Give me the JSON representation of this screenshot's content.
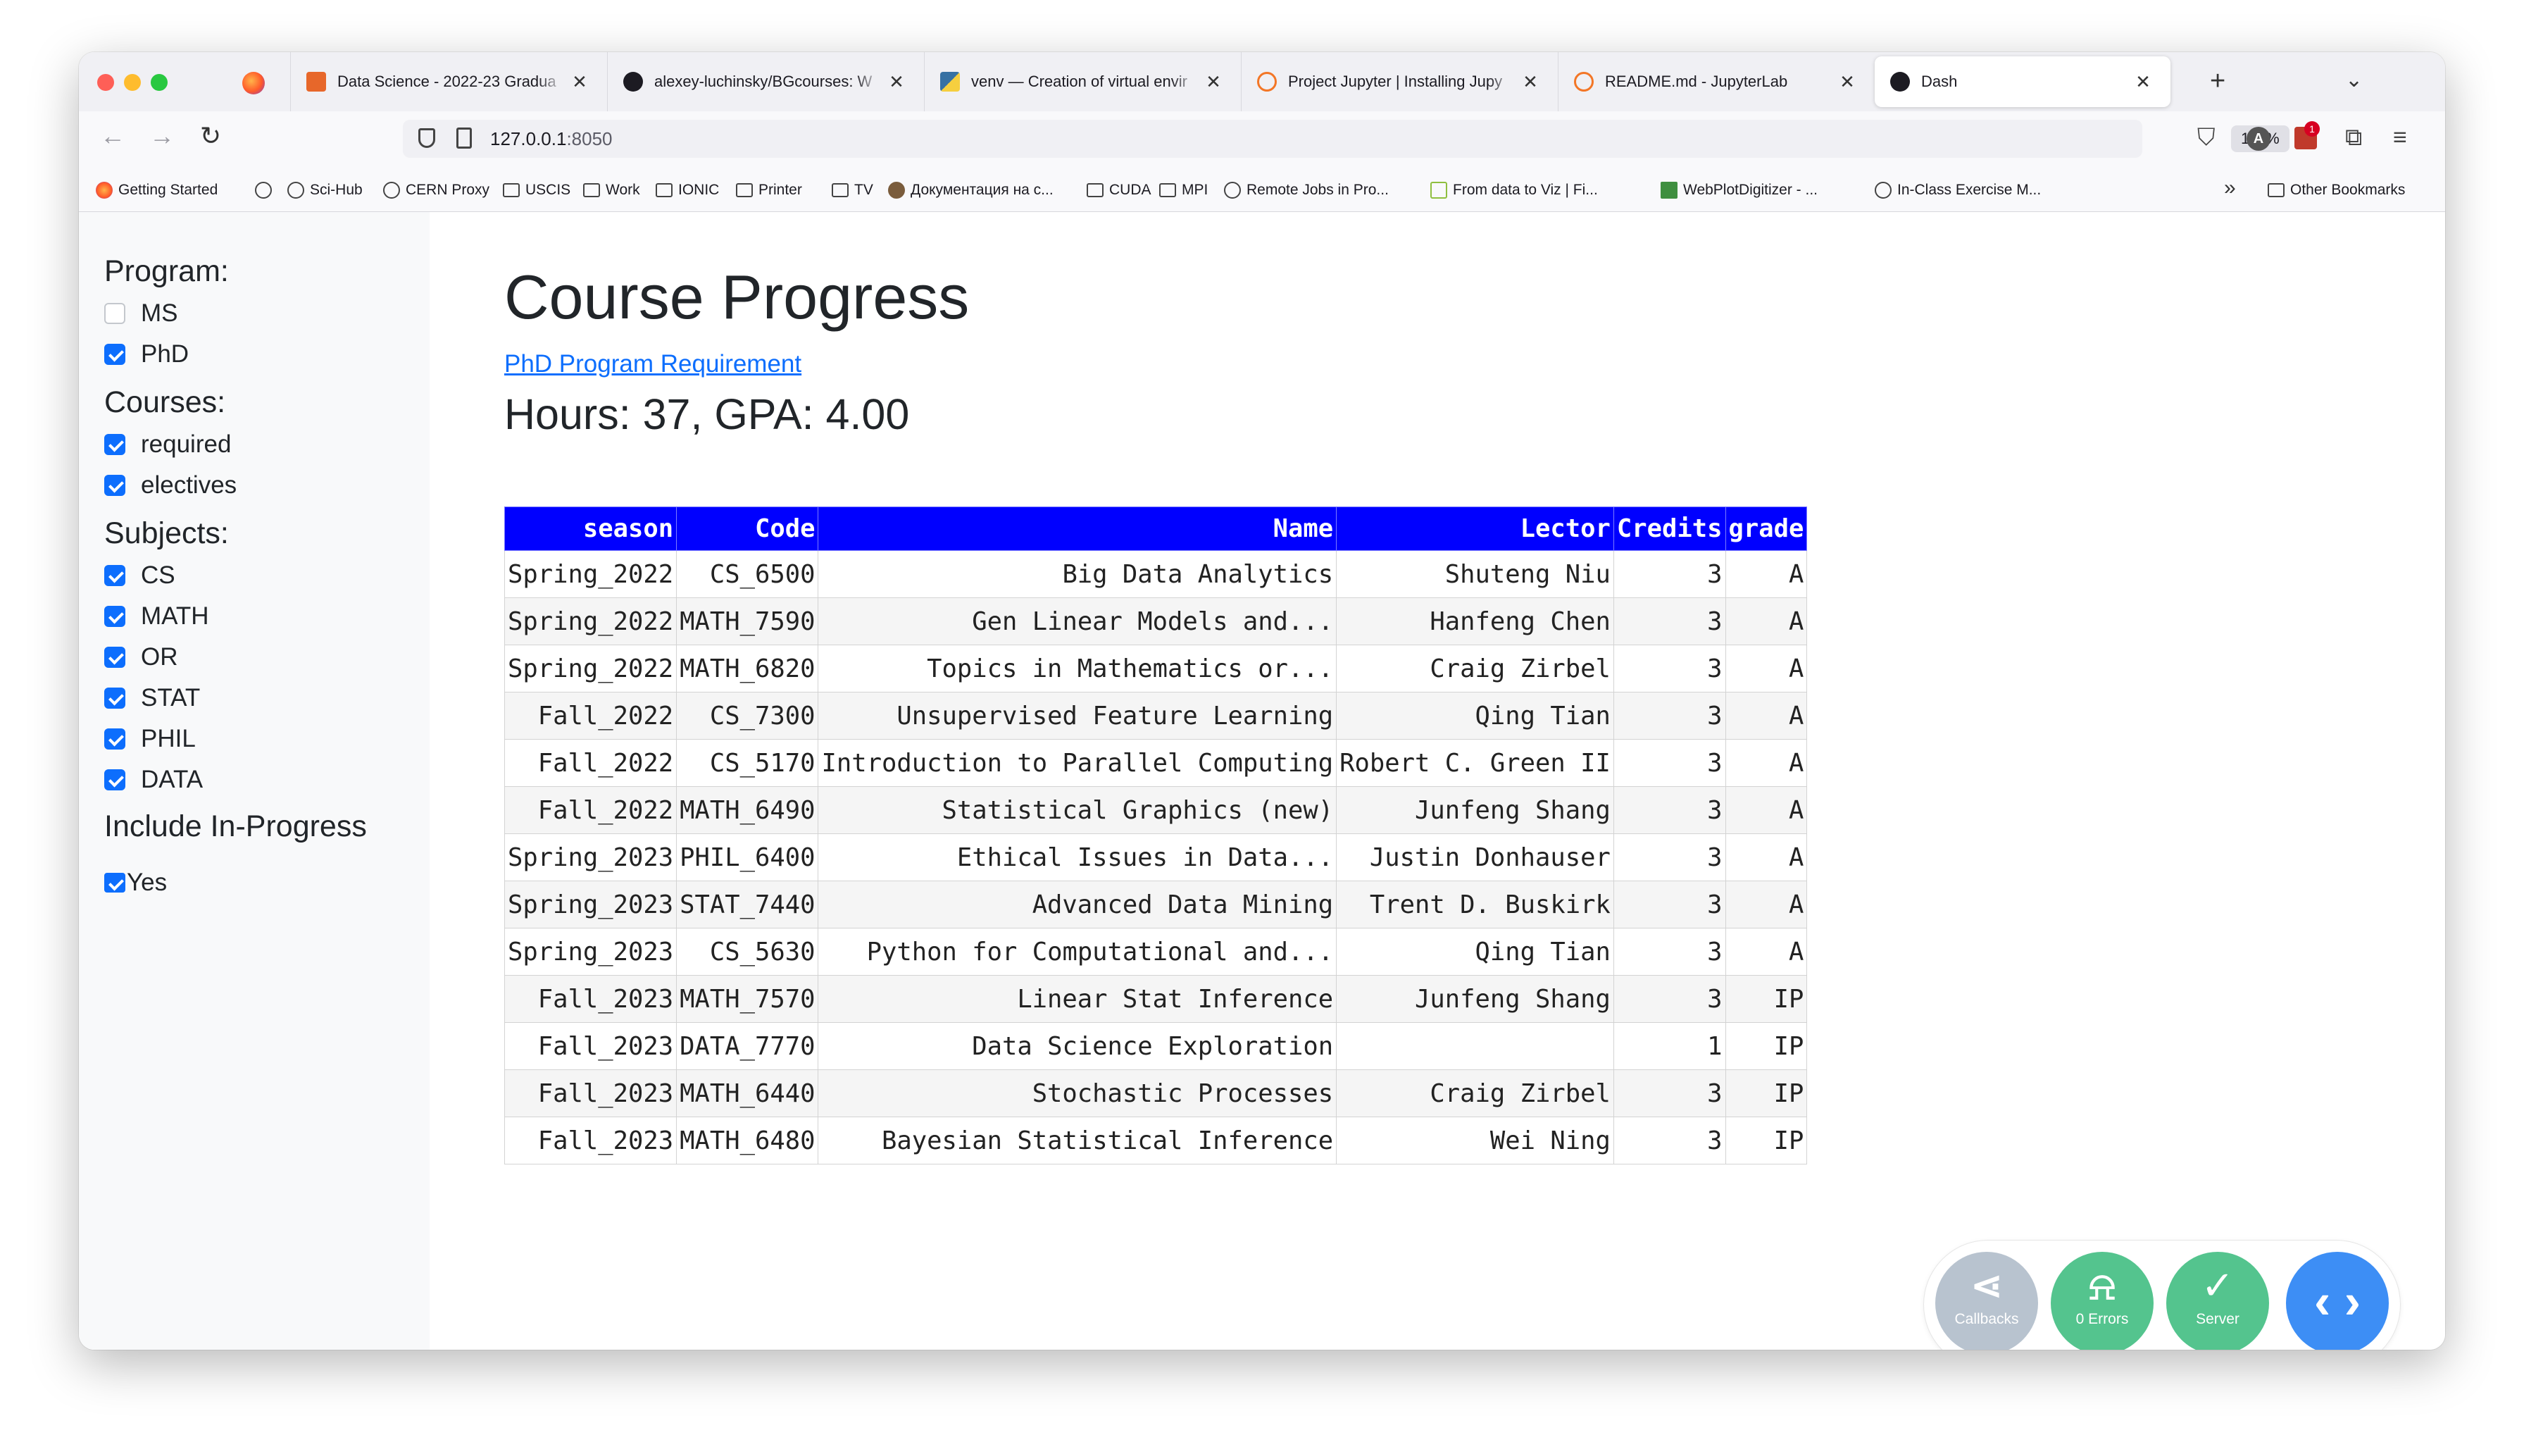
{
  "browser": {
    "tabs": [
      {
        "title": "Data Science - 2022-23 Gradua",
        "icon": "ds-favicon-icon"
      },
      {
        "title": "alexey-luchinsky/BGcourses: W",
        "icon": "github-icon"
      },
      {
        "title": "venv — Creation of virtual envir",
        "icon": "python-icon"
      },
      {
        "title": "Project Jupyter | Installing Jupy",
        "icon": "jupyter-icon"
      },
      {
        "title": "README.md - JupyterLab",
        "icon": "jupyter-icon"
      },
      {
        "title": "Dash",
        "icon": "dash-icon",
        "active": true
      }
    ],
    "close_glyph": "✕",
    "new_tab_glyph": "+",
    "tab_list_glyph": "⌄",
    "url_host": "127.0.0.1",
    "url_port": ":8050",
    "zoom": "110%",
    "avatar_letter": "A",
    "ext_badge": "1",
    "bookmarks": [
      {
        "label": "Getting Started",
        "icon": "fx"
      },
      {
        "label": "",
        "icon": "globe"
      },
      {
        "label": "Sci-Hub",
        "icon": "globe"
      },
      {
        "label": "CERN Proxy",
        "icon": "globe"
      },
      {
        "label": "USCIS",
        "icon": "folder"
      },
      {
        "label": "Work",
        "icon": "folder"
      },
      {
        "label": "IONIC",
        "icon": "folder"
      },
      {
        "label": "Printer",
        "icon": "folder"
      },
      {
        "label": "TV",
        "icon": "folder"
      },
      {
        "label": "Документация на с...",
        "icon": "person"
      },
      {
        "label": "CUDA",
        "icon": "folder"
      },
      {
        "label": "MPI",
        "icon": "folder"
      },
      {
        "label": "Remote Jobs in Pro...",
        "icon": "globe"
      },
      {
        "label": "From data to Viz | Fi...",
        "icon": "viz"
      },
      {
        "label": "WebPlotDigitizer - ...",
        "icon": "wpd"
      },
      {
        "label": "In-Class Exercise M...",
        "icon": "globe"
      }
    ],
    "bookmarks_more": "»",
    "other_bookmarks": "Other Bookmarks"
  },
  "sidebar": {
    "program_heading": "Program:",
    "program_options": [
      {
        "label": "MS",
        "checked": false
      },
      {
        "label": "PhD",
        "checked": true
      }
    ],
    "courses_heading": "Courses:",
    "course_options": [
      {
        "label": "required",
        "checked": true
      },
      {
        "label": "electives",
        "checked": true
      }
    ],
    "subjects_heading": "Subjects:",
    "subject_options": [
      {
        "label": "CS",
        "checked": true
      },
      {
        "label": "MATH",
        "checked": true
      },
      {
        "label": "OR",
        "checked": true
      },
      {
        "label": "STAT",
        "checked": true
      },
      {
        "label": "PHIL",
        "checked": true
      },
      {
        "label": "DATA",
        "checked": true
      }
    ],
    "inprogress_heading": "Include In-Progress",
    "inprogress_option": {
      "label": "Yes",
      "checked": true
    }
  },
  "main": {
    "title": "Course Progress",
    "requirement_link": "PhD Program Requirement",
    "summary": "Hours: 37, GPA: 4.00",
    "table": {
      "columns": [
        "season",
        "Code",
        "Name",
        "Lector",
        "Credits",
        "grade"
      ],
      "rows": [
        [
          "Spring_2022",
          "CS_6500",
          "Big Data Analytics",
          "Shuteng Niu",
          "3",
          "A"
        ],
        [
          "Spring_2022",
          "MATH_7590",
          "Gen Linear Models and...",
          "Hanfeng Chen",
          "3",
          "A"
        ],
        [
          "Spring_2022",
          "MATH_6820",
          "Topics in Mathematics or...",
          "Craig Zirbel",
          "3",
          "A"
        ],
        [
          "Fall_2022",
          "CS_7300",
          "Unsupervised Feature Learning",
          "Qing Tian",
          "3",
          "A"
        ],
        [
          "Fall_2022",
          "CS_5170",
          "Introduction to Parallel Computing",
          "Robert C. Green II",
          "3",
          "A"
        ],
        [
          "Fall_2022",
          "MATH_6490",
          "Statistical Graphics (new)",
          "Junfeng Shang",
          "3",
          "A"
        ],
        [
          "Spring_2023",
          "PHIL_6400",
          "Ethical Issues in Data...",
          "Justin Donhauser",
          "3",
          "A"
        ],
        [
          "Spring_2023",
          "STAT_7440",
          "Advanced Data Mining",
          "Trent D. Buskirk",
          "3",
          "A"
        ],
        [
          "Spring_2023",
          "CS_5630",
          "Python for Computational and...",
          "Qing Tian",
          "3",
          "A"
        ],
        [
          "Fall_2023",
          "MATH_7570",
          "Linear Stat Inference",
          "Junfeng Shang",
          "3",
          "IP"
        ],
        [
          "Fall_2023",
          "DATA_7770",
          "Data Science Exploration",
          "",
          "1",
          "IP"
        ],
        [
          "Fall_2023",
          "MATH_6440",
          "Stochastic Processes",
          "Craig Zirbel",
          "3",
          "IP"
        ],
        [
          "Fall_2023",
          "MATH_6480",
          "Bayesian Statistical Inference",
          "Wei Ning",
          "3",
          "IP"
        ]
      ]
    }
  },
  "debug_menu": {
    "callbacks_label": "Callbacks",
    "errors_label": "0 Errors",
    "server_label": "Server"
  }
}
